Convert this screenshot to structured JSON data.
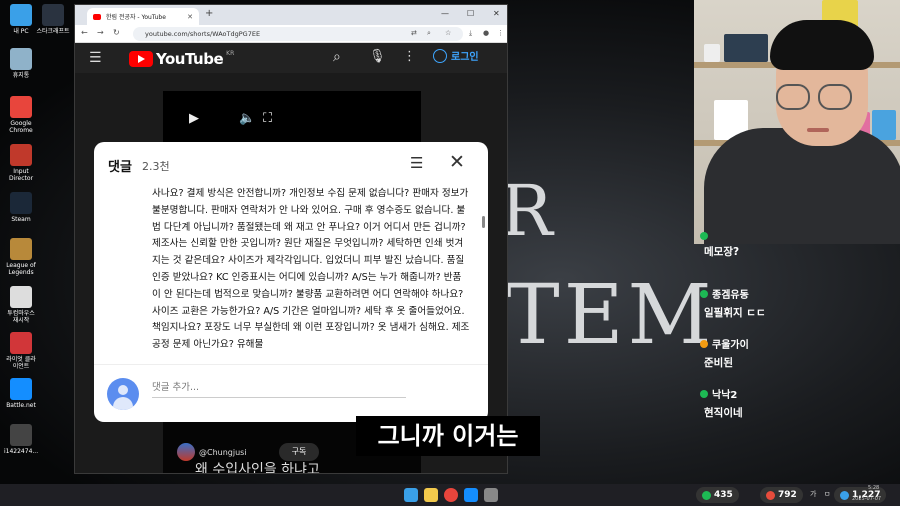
{
  "desktop": {
    "icons": [
      {
        "label": "내 PC",
        "icon": "monitor-icon",
        "color": "#3aa0e8"
      },
      {
        "label": "스타크래프트",
        "icon": "starcraft-icon",
        "color": "#2a3340"
      },
      {
        "label": "휴지통",
        "icon": "recycle-bin-icon",
        "color": "#8fb2c9"
      },
      {
        "label": "Google Chrome",
        "icon": "chrome-icon",
        "color": "#e8453c"
      },
      {
        "label": "Input Director",
        "icon": "input-director-icon",
        "color": "#c0392b"
      },
      {
        "label": "Steam",
        "icon": "steam-icon",
        "color": "#1b2838"
      },
      {
        "label": "League of Legends",
        "icon": "league-icon",
        "color": "#b8893a"
      },
      {
        "label": "투컴마우스 재시작",
        "icon": "mouse-restart-icon",
        "color": "#ddd"
      },
      {
        "label": "라이엇 클라이언트",
        "icon": "riot-icon",
        "color": "#d13639"
      },
      {
        "label": "Battle.net",
        "icon": "battlenet-icon",
        "color": "#148eff"
      },
      {
        "label": "i1422474...",
        "icon": "file-icon",
        "color": "#444"
      }
    ]
  },
  "background": {
    "title_line1": "R",
    "title_line2": "TEM"
  },
  "browser": {
    "tab_title": "한림 전공자 - YouTube",
    "url": "youtube.com/shorts/WAoTdgPG7EE",
    "new_tab": "+",
    "minimize": "—",
    "maximize": "☐",
    "close": "✕"
  },
  "youtube": {
    "logo_text": "YouTube",
    "logo_region": "KR",
    "login_label": "로그인",
    "channel_name": "@Chungjusi",
    "subscribe_label": "구독",
    "video_caption": "왜 수입사인을 하냐고"
  },
  "comments": {
    "title": "댓글",
    "count": "2.3천",
    "text": "사나요? 결제 방식은 안전합니까? 개인정보 수집 문제 없습니다? 판매자 정보가 불분명합니다. 판매자 연락처가 안 나와 있어요. 구매 후 영수증도 없습니다. 불법 다단계 아닙니까? 품절됐는데 왜 재고 안 푸나요? 이거 어디서 만든 겁니까? 제조사는 신뢰할 만한 곳입니까? 원단 재질은 무엇입니까? 세탁하면 인쇄 벗겨지는 것 같은데요? 사이즈가 제각각입니다. 입었더니 피부 발진 났습니다. 품질 인증 받았나요? KC 인증표시는 어디에 있습니까? A/S는 누가 해줍니까? 반품이 안 된다는데 법적으로 맞습니까? 불량품 교환하려면 어디 연락해야 하나요? 사이즈 교환은 가능한가요? A/S 기간은 얼마입니까? 세탁 후 옷 줄어들었어요. 책임지나요? 포장도 너무 부실한데 왜 이런 포장입니까? 옷 냄새가 심해요. 제조공정 문제 아닌가요? 유해물",
    "input_placeholder": "댓글 추가..."
  },
  "subtitle": "그니까 이거는",
  "chat": [
    {
      "user": "",
      "message": "메모장?",
      "badge_color": "#1db954"
    },
    {
      "user": "종겜유동",
      "message": "일필휘지 ㄷㄷ",
      "badge_color": "#1db954"
    },
    {
      "user": "쿠울가이",
      "message": "준비된",
      "badge_color": "#f39c12"
    },
    {
      "user": "낙낙2",
      "message": "현직이네",
      "badge_color": "#1db954"
    }
  ],
  "taskbar": {
    "stat1": "435",
    "stat2": "792",
    "stat3": "1,227",
    "ime1": "가",
    "ime2": "ㅁ",
    "time": "5:28",
    "date": "2025-07-07"
  }
}
